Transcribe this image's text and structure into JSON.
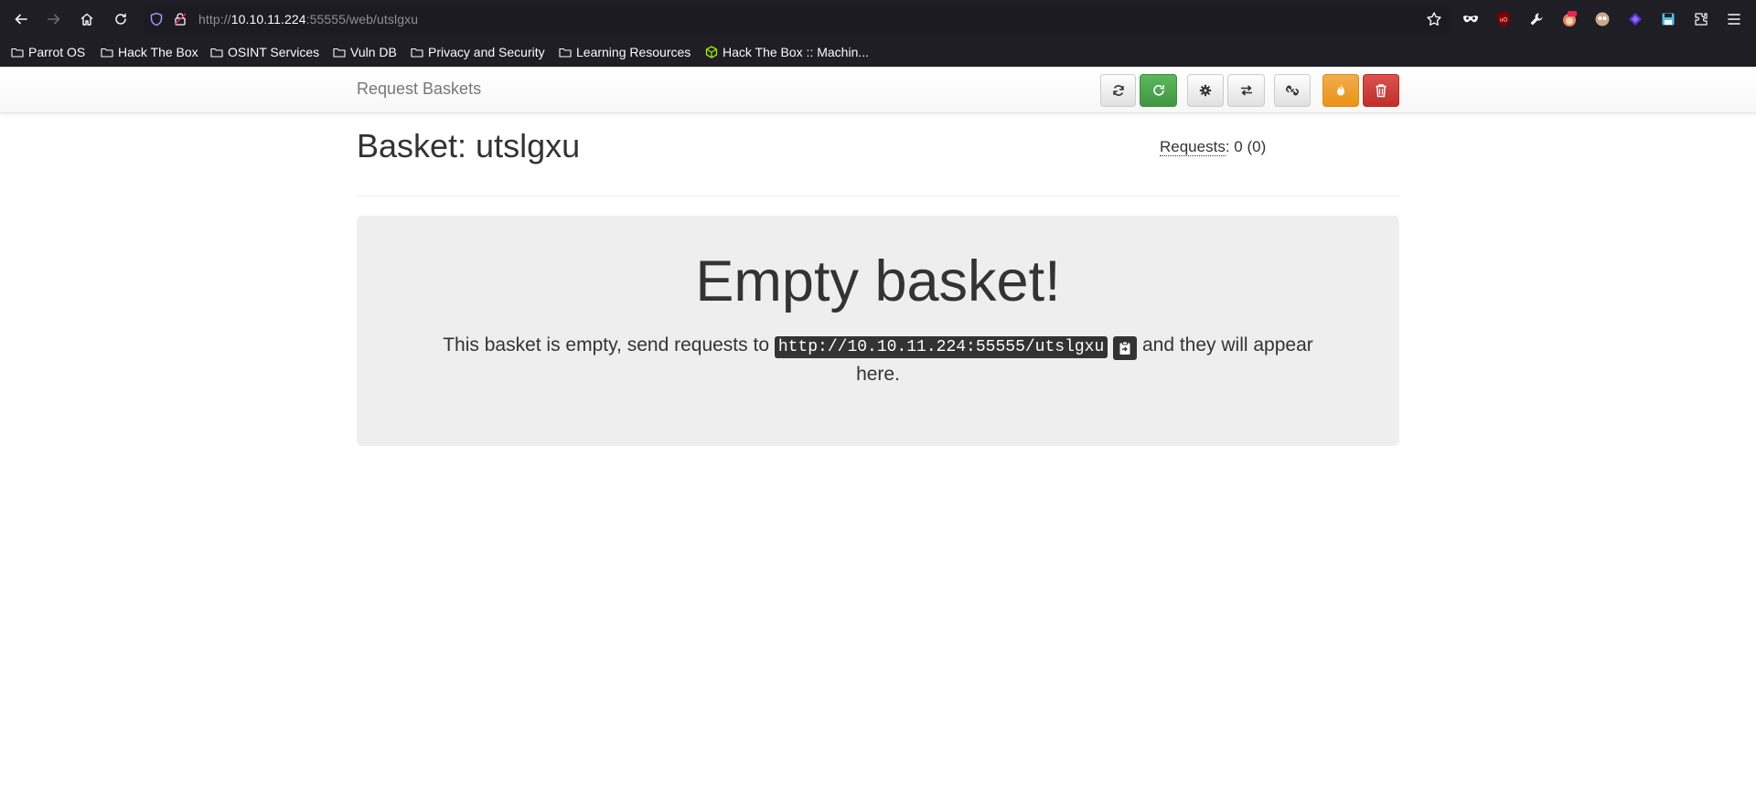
{
  "browser": {
    "url_prefix": "http://",
    "url_host": "10.10.11.224",
    "url_rest": ":55555/web/utslgxu",
    "bookmarks": [
      {
        "label": "Parrot OS",
        "icon": "folder-icon"
      },
      {
        "label": "Hack The Box",
        "icon": "folder-icon"
      },
      {
        "label": "OSINT Services",
        "icon": "folder-icon"
      },
      {
        "label": "Vuln DB",
        "icon": "folder-icon"
      },
      {
        "label": "Privacy and Security",
        "icon": "folder-icon"
      },
      {
        "label": "Learning Resources",
        "icon": "folder-icon"
      },
      {
        "label": "Hack The Box :: Machin...",
        "icon": "htb-cube-icon"
      }
    ],
    "extensions": [
      "mask-icon",
      "ublock-icon",
      "wrench-icon",
      "fox-extension-icon",
      "avatar-extension-icon",
      "shield-extension-icon",
      "save-extension-icon",
      "extensions-icon",
      "menu-icon"
    ]
  },
  "app": {
    "brand": "Request Baskets",
    "toolbar_buttons": [
      "refresh-icon",
      "auto-refresh-icon",
      "settings-icon",
      "responses-icon",
      "share-link-icon",
      "flush-icon",
      "delete-icon"
    ]
  },
  "basket": {
    "title": "Basket: utslgxu",
    "requests_label": "Requests",
    "requests_count": ": 0 (0)"
  },
  "empty": {
    "title": "Empty basket!",
    "text_before": "This basket is empty, send requests to ",
    "url": "http://10.10.11.224:55555/utslgxu",
    "text_after": " and they will appear here."
  },
  "colors": {
    "success": "#5cb85c",
    "warning": "#f0ad4e",
    "danger": "#d9534f",
    "jumbotron": "#eeeeee"
  }
}
